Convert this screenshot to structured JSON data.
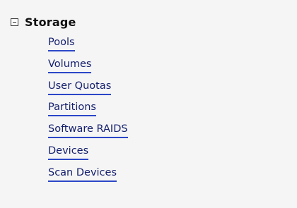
{
  "storage": {
    "title": "Storage",
    "toggle_icon": "collapse-minus-icon",
    "items": [
      {
        "label": "Pools"
      },
      {
        "label": "Volumes"
      },
      {
        "label": "User Quotas"
      },
      {
        "label": "Partitions"
      },
      {
        "label": "Software RAIDS"
      },
      {
        "label": "Devices"
      },
      {
        "label": "Scan Devices"
      }
    ]
  },
  "colors": {
    "background": "#f5f5f5",
    "link_text": "#15206e",
    "link_underline": "#2b47c8"
  }
}
